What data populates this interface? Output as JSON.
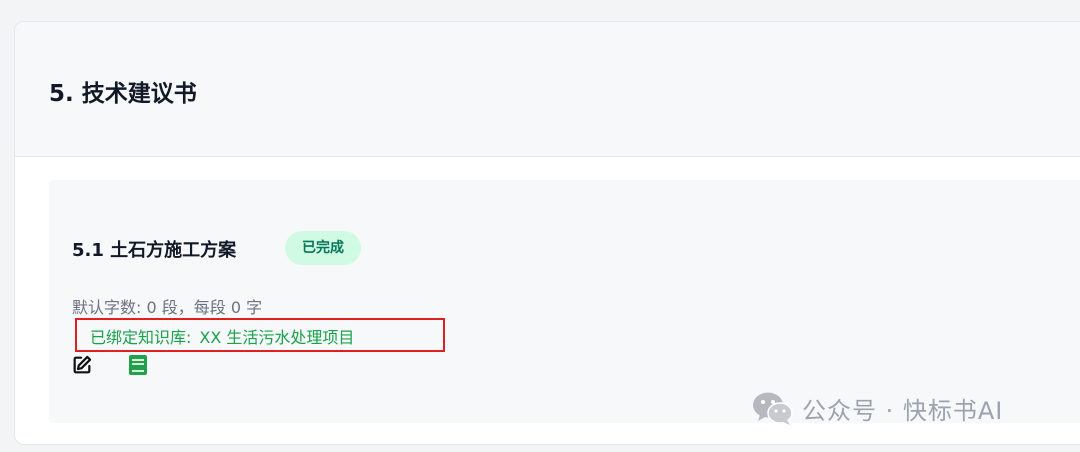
{
  "section": {
    "title": "5. 技术建议书"
  },
  "subsection": {
    "title": "5.1 土石方施工方案",
    "status": "已完成",
    "word_count_text": "默认字数: 0 段，每段 0 字",
    "knowledge_base_label": "已绑定知识库:",
    "knowledge_base_value": "XX 生活污水处理项目"
  },
  "icons": {
    "edit": "edit-icon",
    "knowledge_base": "book-icon"
  },
  "watermark": {
    "text": "公众号 · 快标书AI"
  },
  "colors": {
    "status_bg": "#d1fae5",
    "status_text": "#047857",
    "kb_text": "#16a34a",
    "highlight_border": "#e02020"
  }
}
